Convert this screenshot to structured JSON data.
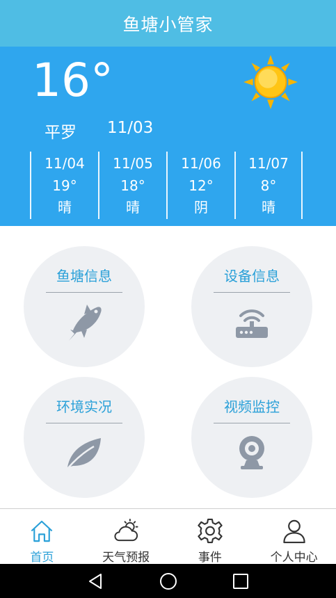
{
  "app": {
    "title": "鱼塘小管家"
  },
  "weather": {
    "temperature": "16°",
    "city": "平罗",
    "date": "11/03",
    "condition_icon": "sun-icon",
    "forecast": [
      {
        "date": "11/04",
        "temp": "19°",
        "condition": "晴"
      },
      {
        "date": "11/05",
        "temp": "18°",
        "condition": "晴"
      },
      {
        "date": "11/06",
        "temp": "12°",
        "condition": "阴"
      },
      {
        "date": "11/07",
        "temp": "8°",
        "condition": "晴"
      }
    ]
  },
  "tiles": [
    {
      "label": "鱼塘信息",
      "icon": "fish-icon"
    },
    {
      "label": "设备信息",
      "icon": "router-icon"
    },
    {
      "label": "环境实况",
      "icon": "leaf-icon"
    },
    {
      "label": "视频监控",
      "icon": "webcam-icon"
    }
  ],
  "nav": {
    "items": [
      {
        "label": "首页",
        "icon": "home-icon",
        "active": true
      },
      {
        "label": "天气预报",
        "icon": "weather-icon",
        "active": false
      },
      {
        "label": "事件",
        "icon": "gear-icon",
        "active": false
      },
      {
        "label": "个人中心",
        "icon": "user-icon",
        "active": false
      }
    ]
  },
  "colors": {
    "title_bar": "#4fbde4",
    "weather_bg": "#2fa6ee",
    "accent": "#2aa0d8",
    "tile_bg": "#eef0f3",
    "icon_gray": "#8e98a6"
  }
}
